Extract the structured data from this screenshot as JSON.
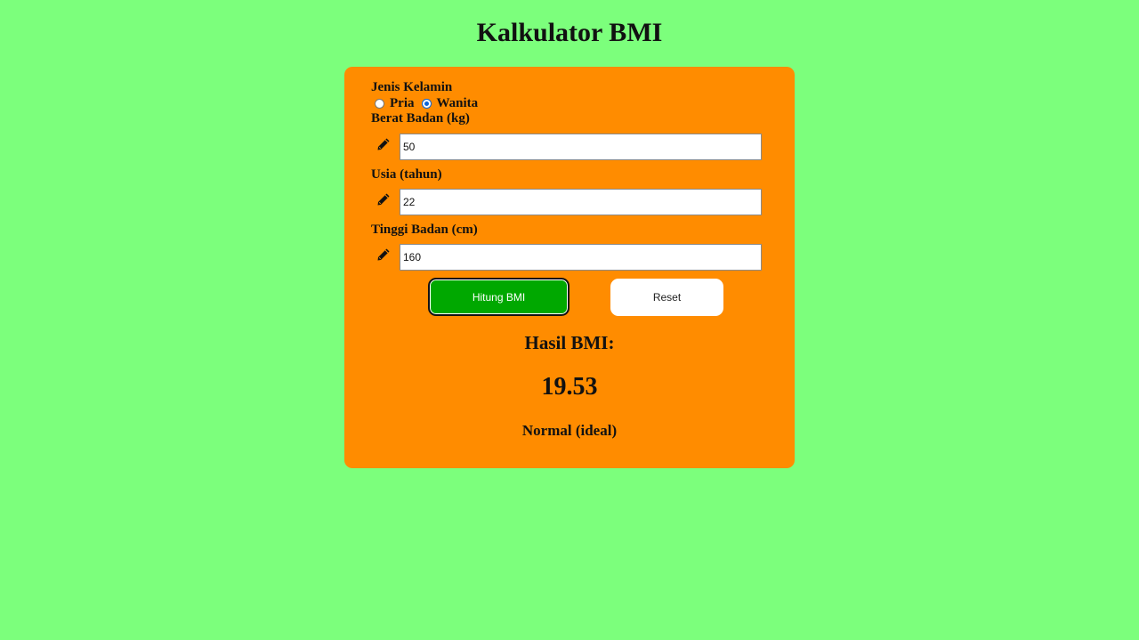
{
  "title": "Kalkulator BMI",
  "form": {
    "gender_label": "Jenis Kelamin",
    "gender_options": [
      {
        "label": "Pria",
        "checked": false
      },
      {
        "label": "Wanita",
        "checked": true
      }
    ],
    "weight_label": "Berat Badan (kg)",
    "weight_value": "50",
    "age_label": "Usia (tahun)",
    "age_value": "22",
    "height_label": "Tinggi Badan (cm)",
    "height_value": "160",
    "field_icon": "pencil-icon"
  },
  "buttons": {
    "calculate_label": "Hitung BMI",
    "reset_label": "Reset"
  },
  "result": {
    "title": "Hasil BMI:",
    "value": "19.53",
    "category": "Normal (ideal)"
  },
  "colors": {
    "background": "#7cff7c",
    "card": "#ff8c00",
    "calculate_button": "#00a800",
    "reset_button": "#ffffff"
  }
}
